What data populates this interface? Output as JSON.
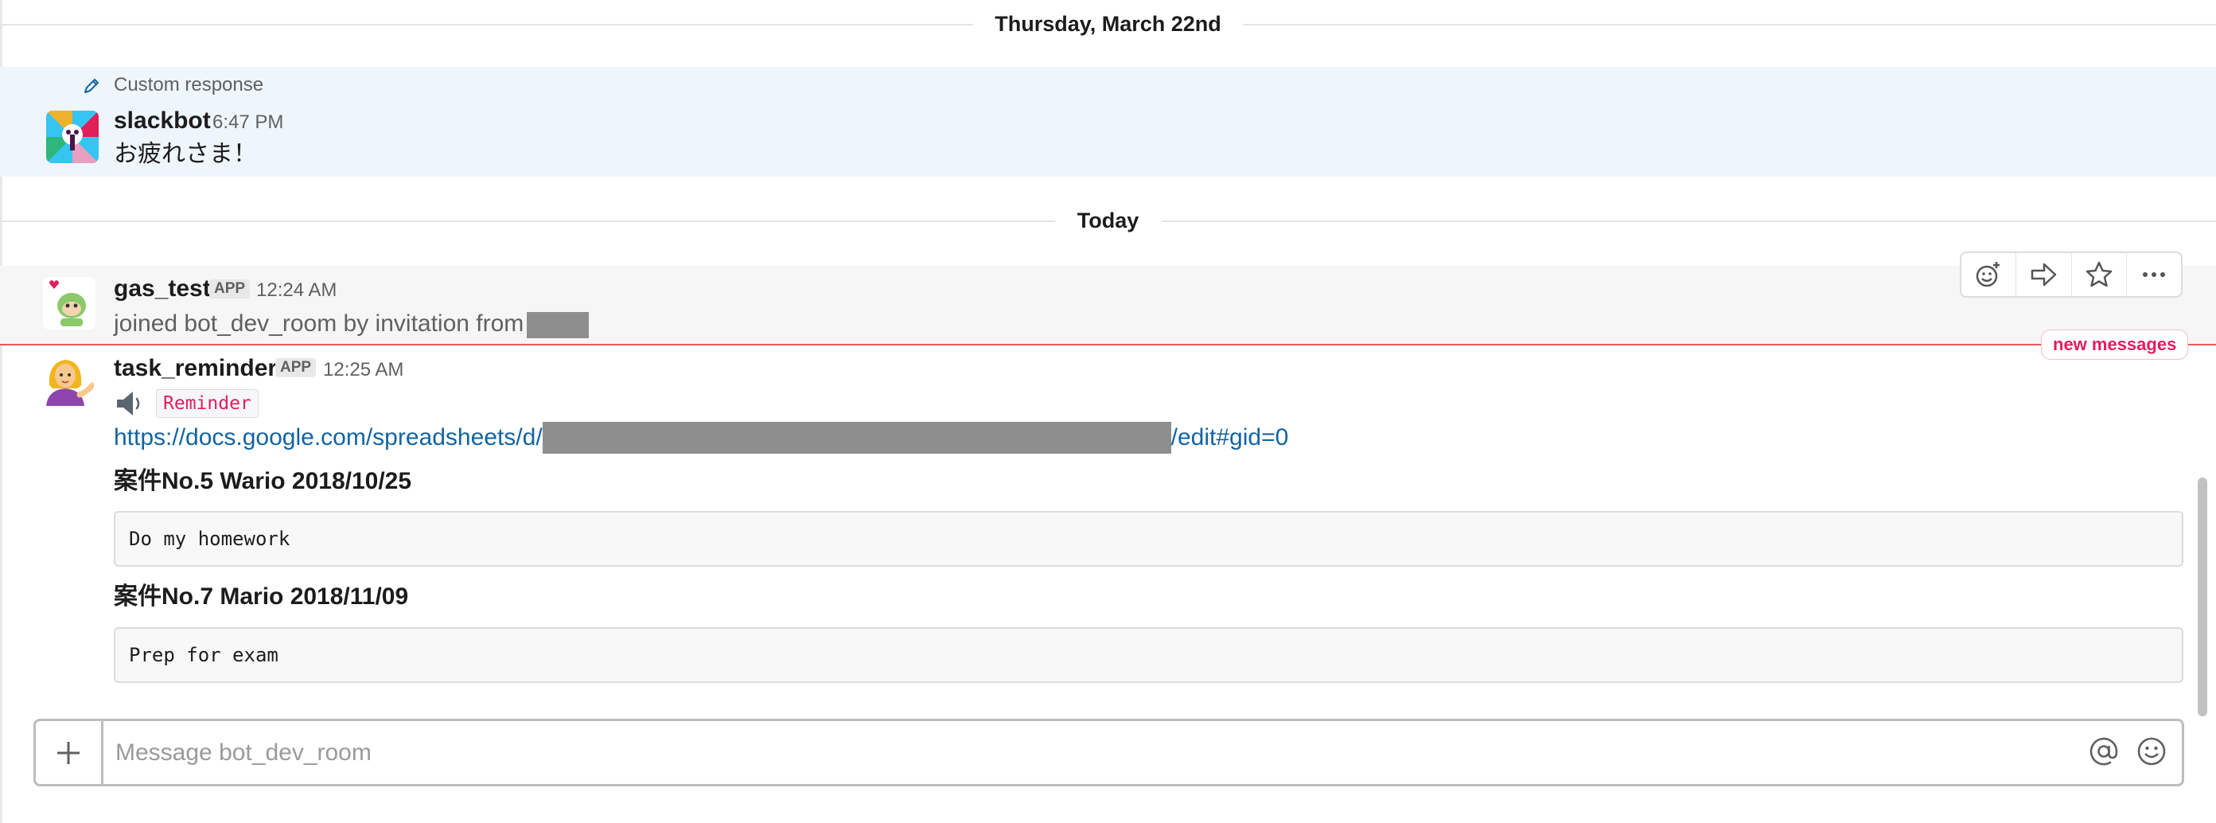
{
  "dividers": {
    "first": "Thursday, March 22nd",
    "second": "Today"
  },
  "messages": [
    {
      "annotation": "Custom response",
      "user": "slackbot",
      "time": "6:47 PM",
      "text": "お疲れさま！"
    },
    {
      "user": "gas_test",
      "badge": "APP",
      "time": "12:24 AM",
      "text": "joined bot_dev_room by invitation from"
    },
    {
      "user": "task_reminder",
      "badge": "APP",
      "time": "12:25 AM",
      "speaker_emoji": "🔈",
      "tag": "Reminder",
      "link_prefix": "https://docs.google.com/spreadsheets/d/",
      "link_suffix": "/edit#gid=0",
      "cases": [
        {
          "title": "案件No.5 Wario 2018/10/25",
          "content": "Do my homework"
        },
        {
          "title": "案件No.7 Mario 2018/11/09",
          "content": "Prep for exam"
        }
      ]
    }
  ],
  "new_messages_label": "new messages",
  "composer": {
    "placeholder": "Message bot_dev_room"
  },
  "icons": {
    "toolbar": [
      "add-reaction-icon",
      "share-icon",
      "star-icon",
      "more-actions-icon"
    ],
    "composer": [
      "plus-icon",
      "mention-icon",
      "emoji-icon"
    ]
  },
  "colors": {
    "accent_link": "#1264a3",
    "new_messages": "#e01e5a",
    "highlight": "#eef6fb"
  }
}
